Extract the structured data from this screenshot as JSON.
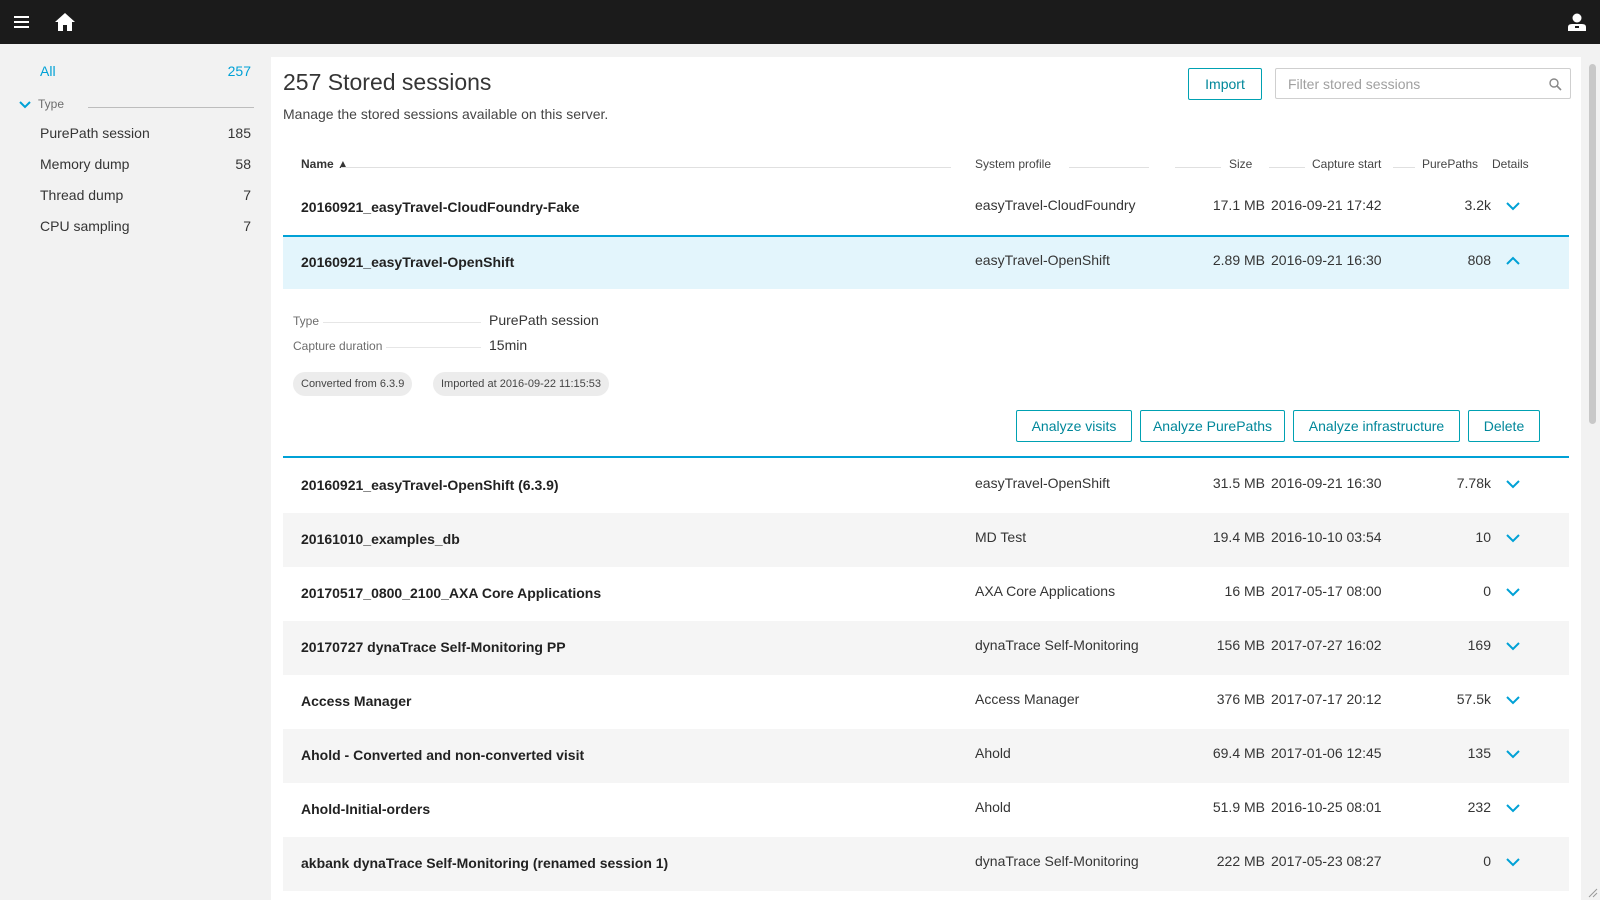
{
  "icons": {
    "menu": "hamburger-icon",
    "home": "home-icon",
    "user": "user-icon",
    "search": "search-icon",
    "expand": "chevron-down-icon",
    "collapse": "chevron-up-icon"
  },
  "colors": {
    "accent": "#00a1d6",
    "topbar": "#1b1b1b",
    "button_border": "#00a1b2",
    "selected_row": "#e3f5fc"
  },
  "sidebar": {
    "all": {
      "label": "All",
      "count": "257"
    },
    "group_label": "Type",
    "items": [
      {
        "label": "PurePath session",
        "count": "185"
      },
      {
        "label": "Memory dump",
        "count": "58"
      },
      {
        "label": "Thread dump",
        "count": "7"
      },
      {
        "label": "CPU sampling",
        "count": "7"
      }
    ]
  },
  "header": {
    "title": "257 Stored sessions",
    "subtitle": "Manage the stored sessions available on this server.",
    "import_label": "Import",
    "filter_placeholder": "Filter stored sessions"
  },
  "table": {
    "columns": {
      "name": "Name ▲",
      "profile": "System profile",
      "size": "Size",
      "capture": "Capture start",
      "purepaths": "PurePaths",
      "details": "Details"
    },
    "rows": [
      {
        "name": "20160921_easyTravel-CloudFoundry-Fake",
        "profile": "easyTravel-CloudFoundry",
        "size": "17.1 MB",
        "capture": "2016-09-21 17:42",
        "purepaths": "3.2k"
      },
      {
        "name": "20160921_easyTravel-OpenShift",
        "profile": "easyTravel-OpenShift",
        "size": "2.89 MB",
        "capture": "2016-09-21 16:30",
        "purepaths": "808"
      },
      {
        "name": "20160921_easyTravel-OpenShift (6.3.9)",
        "profile": "easyTravel-OpenShift",
        "size": "31.5 MB",
        "capture": "2016-09-21 16:30",
        "purepaths": "7.78k"
      },
      {
        "name": "20161010_examples_db",
        "profile": "MD Test",
        "size": "19.4 MB",
        "capture": "2016-10-10 03:54",
        "purepaths": "10"
      },
      {
        "name": "20170517_0800_2100_AXA Core Applications",
        "profile": "AXA Core Applications",
        "size": "16 MB",
        "capture": "2017-05-17 08:00",
        "purepaths": "0"
      },
      {
        "name": "20170727 dynaTrace Self-Monitoring PP",
        "profile": "dynaTrace Self-Monitoring",
        "size": "156 MB",
        "capture": "2017-07-27 16:02",
        "purepaths": "169"
      },
      {
        "name": "Access Manager",
        "profile": "Access Manager",
        "size": "376 MB",
        "capture": "2017-07-17 20:12",
        "purepaths": "57.5k"
      },
      {
        "name": "Ahold - Converted and non-converted visit",
        "profile": "Ahold",
        "size": "69.4 MB",
        "capture": "2017-01-06 12:45",
        "purepaths": "135"
      },
      {
        "name": "Ahold-Initial-orders",
        "profile": "Ahold",
        "size": "51.9 MB",
        "capture": "2016-10-25 08:01",
        "purepaths": "232"
      },
      {
        "name": "akbank dynaTrace Self-Monitoring (renamed session 1)",
        "profile": "dynaTrace Self-Monitoring",
        "size": "222 MB",
        "capture": "2017-05-23 08:27",
        "purepaths": "0"
      }
    ]
  },
  "detail": {
    "type_label": "Type",
    "type_value": "PurePath session",
    "duration_label": "Capture duration",
    "duration_value": "15min",
    "tags": [
      "Converted from 6.3.9",
      "Imported at 2016-09-22 11:15:53"
    ],
    "actions": {
      "analyze_visits": "Analyze visits",
      "analyze_purepaths": "Analyze PurePaths",
      "analyze_infrastructure": "Analyze infrastructure",
      "delete": "Delete"
    }
  }
}
